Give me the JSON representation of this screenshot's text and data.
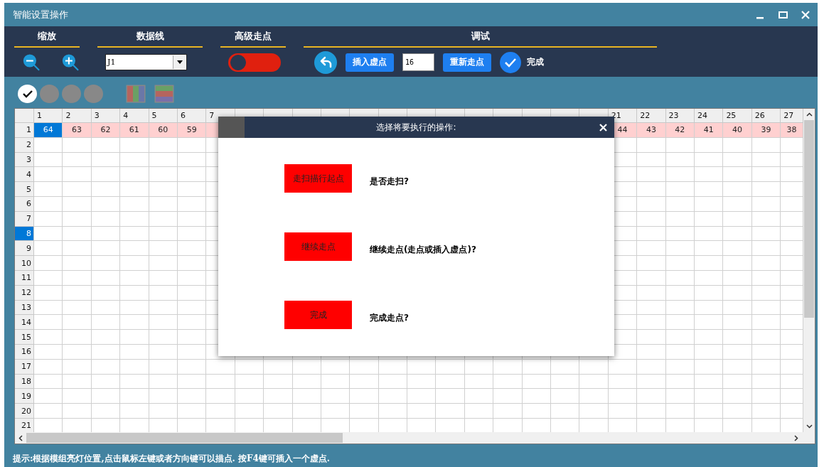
{
  "window": {
    "title": "智能设置操作"
  },
  "toolbar": {
    "sections": [
      {
        "kind": "zoom",
        "title": "缩放"
      },
      {
        "kind": "dataline",
        "title": "数据线",
        "value": "J1"
      },
      {
        "kind": "advanced",
        "title": "高级走点",
        "on": false
      },
      {
        "kind": "debug",
        "title": "调试",
        "insert_button": "插入虚点",
        "count": "16",
        "redo_button": "重新走点",
        "done": "完成"
      }
    ]
  },
  "modes": [
    {
      "selected": true
    },
    {
      "selected": false
    },
    {
      "selected": false
    },
    {
      "selected": false
    }
  ],
  "table": {
    "columns": [
      {
        "label": "1"
      },
      {
        "label": "2"
      },
      {
        "label": "3"
      },
      {
        "label": "4"
      },
      {
        "label": "5"
      },
      {
        "label": "6"
      },
      {
        "label": "7"
      },
      {},
      {},
      {},
      {},
      {},
      {},
      {},
      {},
      {},
      {},
      {},
      {},
      {},
      {
        "label": "21"
      },
      {
        "label": "22"
      },
      {
        "label": "23"
      },
      {
        "label": "24"
      },
      {
        "label": "25"
      },
      {
        "label": "26"
      },
      {
        "label": "27"
      }
    ],
    "rows": [
      {
        "label": "1",
        "selected": false,
        "highlighted": true,
        "cells": [
          {
            "text": "64",
            "selected": true
          },
          {
            "text": "63",
            "selected": false
          },
          {
            "text": "62",
            "selected": false
          },
          {
            "text": "61",
            "selected": false
          },
          {
            "text": "60",
            "selected": false
          },
          {
            "text": "59",
            "selected": false
          },
          {
            "selected": false
          },
          null,
          null,
          null,
          null,
          null,
          null,
          null,
          null,
          null,
          null,
          null,
          null,
          null,
          {
            "text": "44",
            "selected": false
          },
          {
            "text": "43",
            "selected": false
          },
          {
            "text": "42",
            "selected": false
          },
          {
            "text": "41",
            "selected": false
          },
          {
            "text": "40",
            "selected": false
          },
          {
            "text": "39",
            "selected": false
          },
          {
            "text": "38",
            "selected": false
          }
        ]
      },
      {
        "label": "2",
        "selected": false,
        "highlighted": false
      },
      {
        "label": "3",
        "selected": false,
        "highlighted": false
      },
      {
        "label": "4",
        "selected": false,
        "highlighted": false
      },
      {
        "label": "5",
        "selected": false,
        "highlighted": false
      },
      {
        "label": "6",
        "selected": false,
        "highlighted": false
      },
      {
        "label": "7",
        "selected": false,
        "highlighted": false
      },
      {
        "label": "8",
        "selected": true,
        "highlighted": false
      },
      {
        "label": "9",
        "selected": false,
        "highlighted": false
      },
      {
        "label": "10",
        "selected": false,
        "highlighted": false
      },
      {
        "label": "11",
        "selected": false,
        "highlighted": false
      },
      {
        "label": "12",
        "selected": false,
        "highlighted": false
      },
      {
        "label": "13",
        "selected": false,
        "highlighted": false
      },
      {
        "label": "14",
        "selected": false,
        "highlighted": false
      },
      {
        "label": "15",
        "selected": false,
        "highlighted": false
      },
      {
        "label": "16",
        "selected": false,
        "highlighted": false
      },
      {
        "label": "17",
        "selected": false,
        "highlighted": false
      },
      {
        "label": "18",
        "selected": false,
        "highlighted": false
      },
      {
        "label": "19",
        "selected": false,
        "highlighted": false
      },
      {
        "label": "20",
        "selected": false,
        "highlighted": false
      },
      {
        "label": "21",
        "selected": false,
        "highlighted": false
      }
    ]
  },
  "dialog": {
    "title": "选择将要执行的操作:",
    "options": [
      {
        "button": "走扫描行起点",
        "question": "是否走扫?"
      },
      {
        "button": "继续走点",
        "question": "继续走点(走点或插入虚点)?"
      },
      {
        "button": "完成",
        "question": "完成走点?"
      }
    ]
  },
  "status_bar": "提示:根据模组亮灯位置,点击鼠标左键或者方向键可以描点. 按F4键可插入一个虚点."
}
